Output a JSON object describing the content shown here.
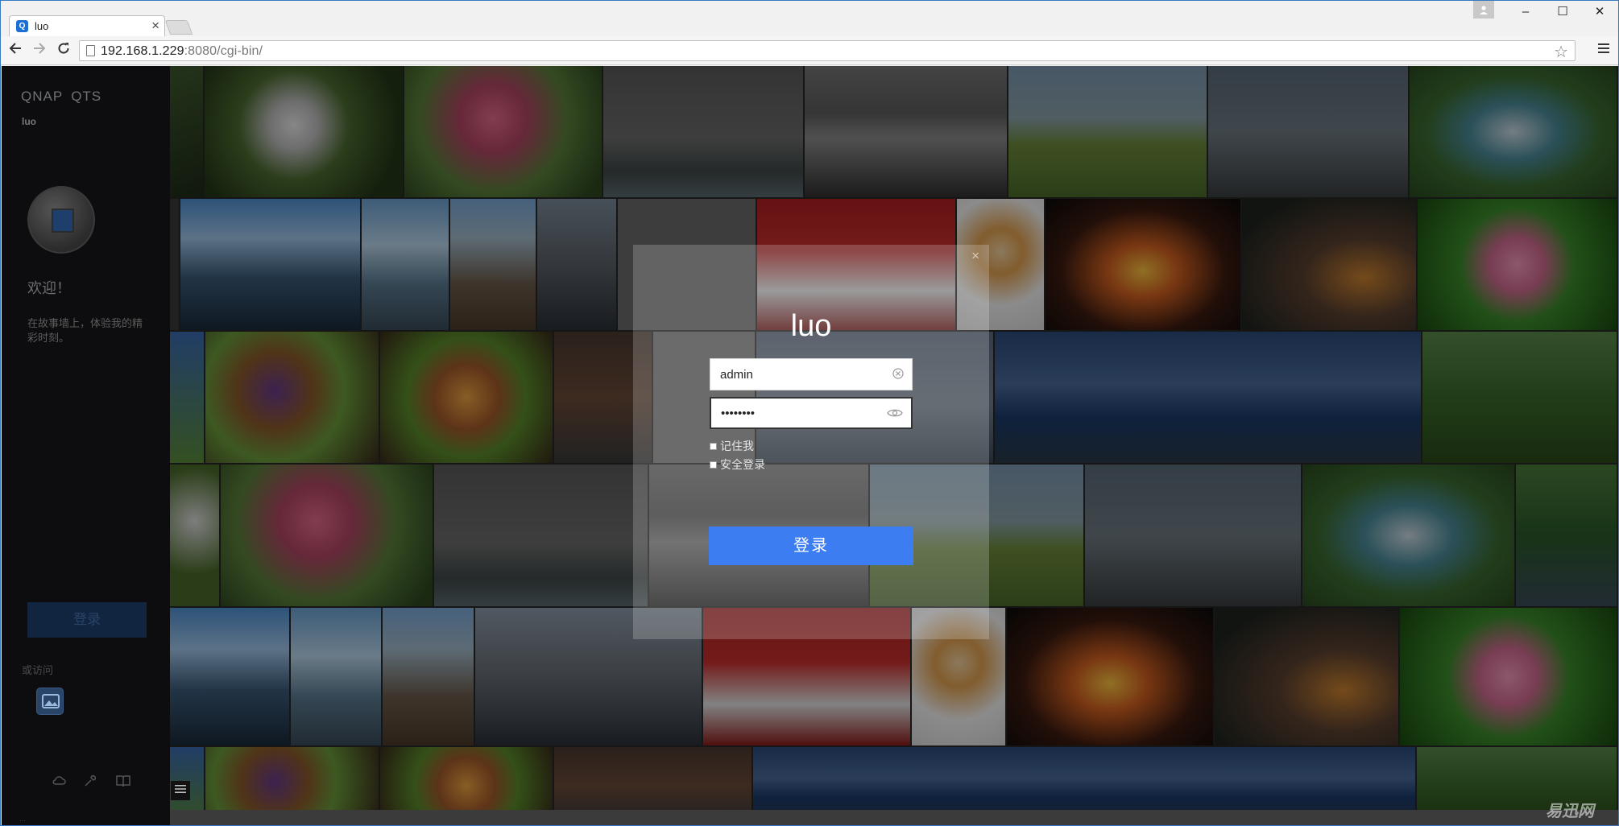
{
  "browser": {
    "tab_title": "luo",
    "tab_favicon_text": "Q",
    "tab_close": "×",
    "url_host": "192.168.1.229",
    "url_rest": ":8080/cgi-bin/",
    "back_icon": "arrow-left-icon",
    "forward_icon": "arrow-right-icon",
    "reload_icon": "reload-icon",
    "bookmark_icon": "star-icon",
    "menu_icon": "hamburger-icon"
  },
  "window_controls": {
    "minimize": "–",
    "maximize": "☐",
    "close": "✕"
  },
  "sidebar": {
    "brand_1": "QNAP",
    "brand_2": "QTS",
    "hostname": "luo",
    "welcome": "欢迎！",
    "slogan": "在故事墙上，体验我的精彩时刻。",
    "login_label": "登录",
    "or_visit": "或访问",
    "gallery_icon": "photo-gallery-icon",
    "bottom_icons": [
      "cloud-icon",
      "tools-icon",
      "book-icon"
    ],
    "bottom_text": "..."
  },
  "dialog": {
    "title": "luo",
    "close": "×",
    "username_value": "admin",
    "password_value": "••••••••",
    "remember_label": "记住我",
    "secure_label": "安全登录",
    "login_button": "登录"
  },
  "watermark": "易迅网",
  "colors": {
    "accent": "#3c7ef1",
    "sidebar_bg": "#0d0d0f",
    "side_login_bg": "#122540"
  }
}
